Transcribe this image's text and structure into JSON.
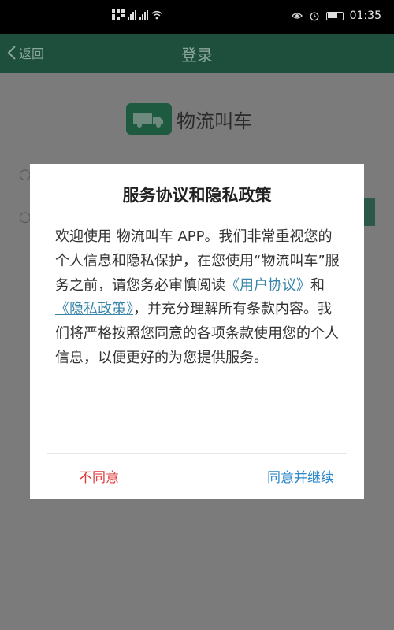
{
  "status_bar": {
    "time": "01:35"
  },
  "header": {
    "back_label": "返回",
    "title": "登录"
  },
  "brand": {
    "name": "物流叫车"
  },
  "dialog": {
    "title": "服务协议和隐私政策",
    "body_intro": "欢迎使用 物流叫车 APP。我们非常重视您的个人信息和隐私保护，在您使用“物流叫车”服务之前，请您务必审慎阅读",
    "user_agreement_link": "《用户协议》",
    "connector": "和",
    "privacy_policy_link": "《隐私政策》",
    "body_outro": "，并充分理解所有条款内容。我们将严格按照您同意的各项条款使用您的个人信息，以便更好的为您提供服务。",
    "decline_label": "不同意",
    "accept_label": "同意并继续"
  },
  "colors": {
    "accent": "#1e5a40",
    "decline": "#e03a3a",
    "accept": "#2a86c8",
    "link": "#3a86a8"
  }
}
